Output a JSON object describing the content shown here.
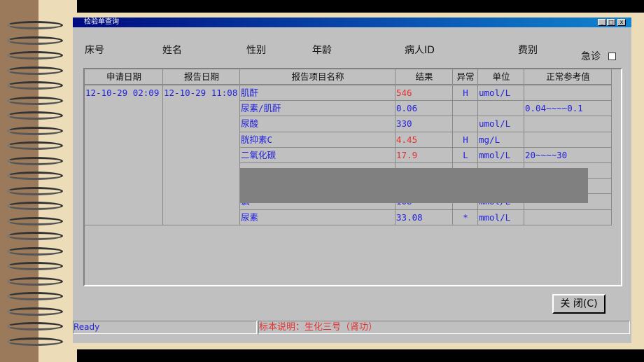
{
  "window": {
    "title": "检验单查询"
  },
  "patient_fields": [
    "床号",
    "姓名",
    "性别",
    "年龄",
    "病人ID",
    "费别"
  ],
  "emergency_label": "急诊",
  "emergency_checked": false,
  "table": {
    "columns": [
      "申请日期",
      "报告日期",
      "报告项目名称",
      "结果",
      "异常",
      "单位",
      "正常参考值"
    ],
    "request_date": "12-10-29 02:09",
    "report_date": "12-10-29 11:08",
    "rows": [
      {
        "name": "肌酐",
        "result": "546",
        "flag": "H",
        "unit": "umol/L",
        "ref": "",
        "abnormal": true
      },
      {
        "name": "尿素/肌酐",
        "result": "0.06",
        "flag": "",
        "unit": "",
        "ref": "0.04~~~~0.1",
        "abnormal": false
      },
      {
        "name": "尿酸",
        "result": "330",
        "flag": "",
        "unit": "umol/L",
        "ref": "",
        "abnormal": false
      },
      {
        "name": "胱抑素C",
        "result": "4.45",
        "flag": "H",
        "unit": "mg/L",
        "ref": "",
        "abnormal": true
      },
      {
        "name": "二氧化碳",
        "result": "17.9",
        "flag": "L",
        "unit": "mmol/L",
        "ref": "20~~~~30",
        "abnormal": true
      },
      {
        "name": "",
        "result": "",
        "flag": "",
        "unit": "",
        "ref": "",
        "abnormal": false
      },
      {
        "name": "",
        "result": "",
        "flag": "",
        "unit": "",
        "ref": "",
        "abnormal": false
      },
      {
        "name": "氯",
        "result": "108",
        "flag": "",
        "unit": "mmol/L",
        "ref": "",
        "abnormal": false
      },
      {
        "name": "尿素",
        "result": "33.08",
        "flag": "*",
        "unit": "mmol/L",
        "ref": "",
        "abnormal": false
      }
    ]
  },
  "close_button": "关 闭(C)",
  "status": {
    "left": "Ready",
    "right": "标本说明：生化三号（肾功）"
  }
}
